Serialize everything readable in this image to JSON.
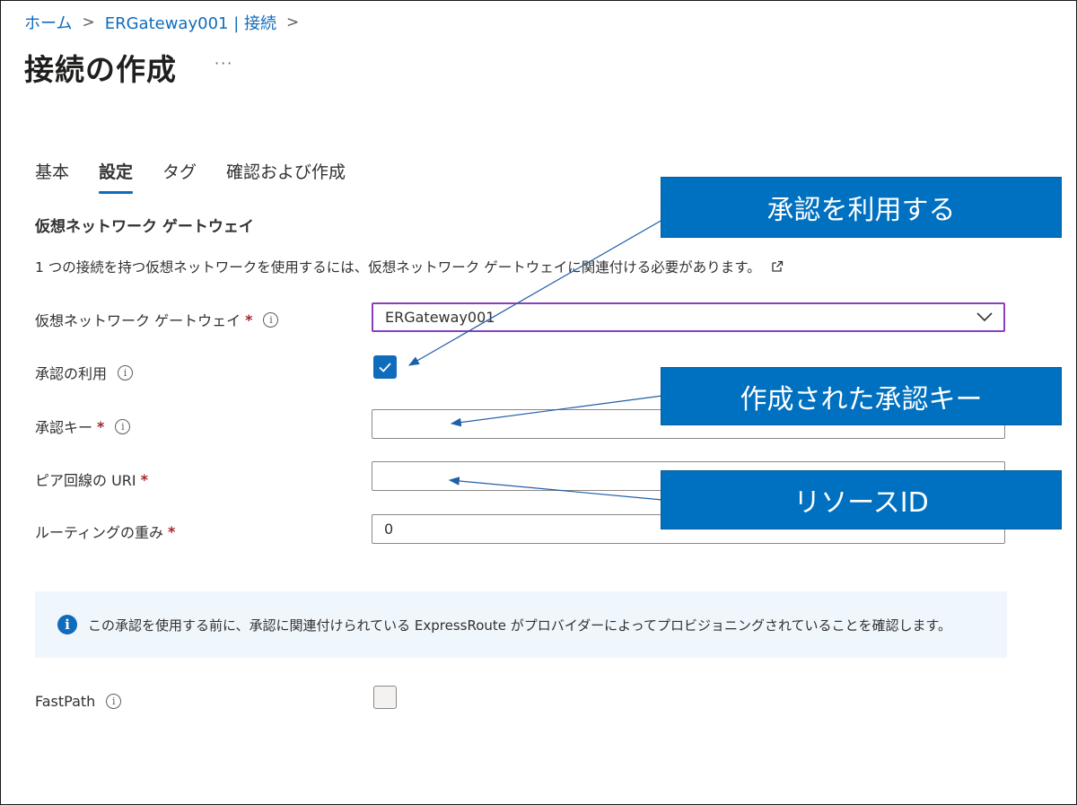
{
  "breadcrumb": {
    "home": "ホーム",
    "resource": "ERGateway001 | 接続",
    "separator": ">"
  },
  "page": {
    "title": "接続の作成",
    "more": "···"
  },
  "tabs": [
    "基本",
    "設定",
    "タグ",
    "確認および作成"
  ],
  "active_tab": "設定",
  "section": {
    "title": "仮想ネットワーク ゲートウェイ",
    "description": "1 つの接続を持つ仮想ネットワークを使用するには、仮想ネットワーク ゲートウェイに関連付ける必要があります。"
  },
  "form": {
    "gateway": {
      "label": "仮想ネットワーク ゲートウェイ",
      "required": "*",
      "value": "ERGateway001"
    },
    "use_authorization": {
      "label": "承認の利用",
      "checked": true
    },
    "auth_key": {
      "label": "承認キー",
      "required": "*",
      "value": ""
    },
    "peer_uri": {
      "label": "ピア回線の URI",
      "required": "*",
      "value": ""
    },
    "routing_weight": {
      "label": "ルーティングの重み",
      "required": "*",
      "value": "0"
    },
    "fastpath": {
      "label": "FastPath",
      "checked": false
    }
  },
  "info_message": "この承認を使用する前に、承認に関連付けられている ExpressRoute がプロバイダーによってプロビジョニングされていることを確認します。",
  "callouts": {
    "use_authorization": "承認を利用する",
    "created_key": "作成された承認キー",
    "resource_id": "リソースID"
  },
  "colors": {
    "accent": "#0f6cbd",
    "callout": "#0070c0",
    "required": "#a4262c",
    "select_border": "#8a3fbf"
  },
  "icons": [
    "chevron-right-icon",
    "more-icon",
    "external-link-icon",
    "info-icon",
    "chevron-down-icon",
    "checkmark-icon"
  ]
}
